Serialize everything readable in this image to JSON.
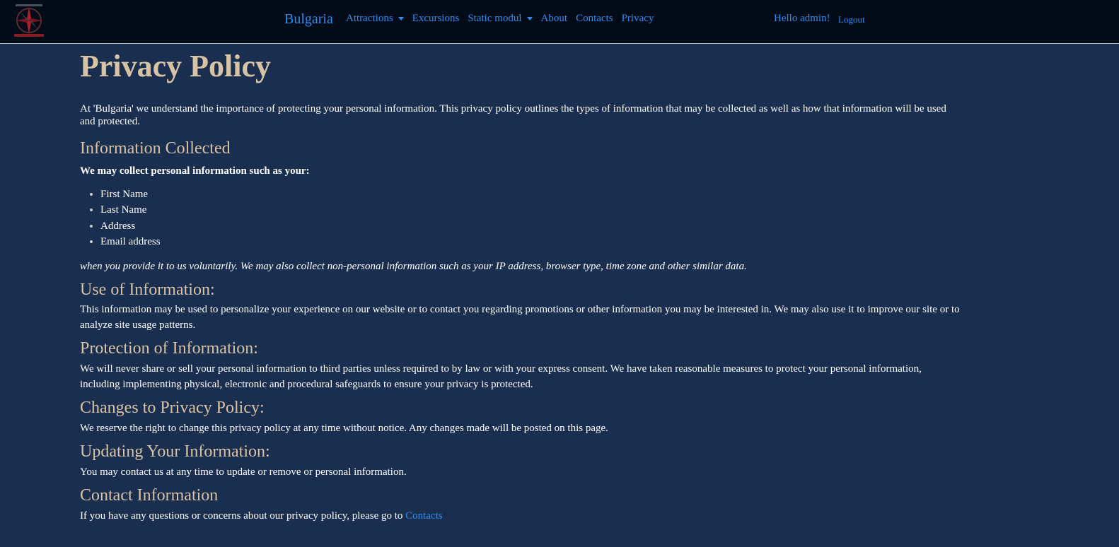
{
  "navbar": {
    "brand": "Bulgaria",
    "items": [
      {
        "label": "Attractions",
        "dropdown": true
      },
      {
        "label": "Excursions",
        "dropdown": false
      },
      {
        "label": "Static modul",
        "dropdown": true
      },
      {
        "label": "About",
        "dropdown": false
      },
      {
        "label": "Contacts",
        "dropdown": false
      },
      {
        "label": "Privacy",
        "dropdown": false
      }
    ],
    "greeting": "Hello admin!",
    "logout": "Logout"
  },
  "page": {
    "title": "Privacy Policy",
    "intro": "At 'Bulgaria' we understand the importance of protecting your personal information. This privacy policy outlines the types of information that may be collected as well as how that information will be used and protected.",
    "info_collected": {
      "heading": "Information Collected",
      "lead": "We may collect personal information such as your:",
      "items": [
        "First Name",
        "Last Name",
        "Address",
        "Email address"
      ],
      "note": "when you provide it to us voluntarily. We may also collect non-personal information such as your IP address, browser type, time zone and other similar data."
    },
    "use": {
      "heading": "Use of Information:",
      "text": "This information may be used to personalize your experience on our website or to contact you regarding promotions or other information you may be interested in. We may also use it to improve our site or to analyze site usage patterns."
    },
    "protection": {
      "heading": "Protection of Information:",
      "text": "We will never share or sell your personal information to third parties unless required to by law or with your express consent. We have taken reasonable measures to protect your personal information, including implementing physical, electronic and procedural safeguards to ensure your privacy is protected."
    },
    "changes": {
      "heading": "Changes to Privacy Policy:",
      "text": "We reserve the right to change this privacy policy at any time without notice. Any changes made will be posted on this page."
    },
    "updating": {
      "heading": "Updating Your Information:",
      "text": "You may contact us at any time to update or remove or personal information."
    },
    "contact": {
      "heading": "Contact Information",
      "text": "If you have any questions or concerns about our privacy policy, please go to",
      "link": "Contacts"
    }
  },
  "colors": {
    "background": "#1a2e4f",
    "navbar": "#020b18",
    "link": "#2f8cf0",
    "heading": "#d8c3a4"
  },
  "icons": {
    "logo": "compass-star-logo",
    "dropdown": "caret-down-icon"
  }
}
